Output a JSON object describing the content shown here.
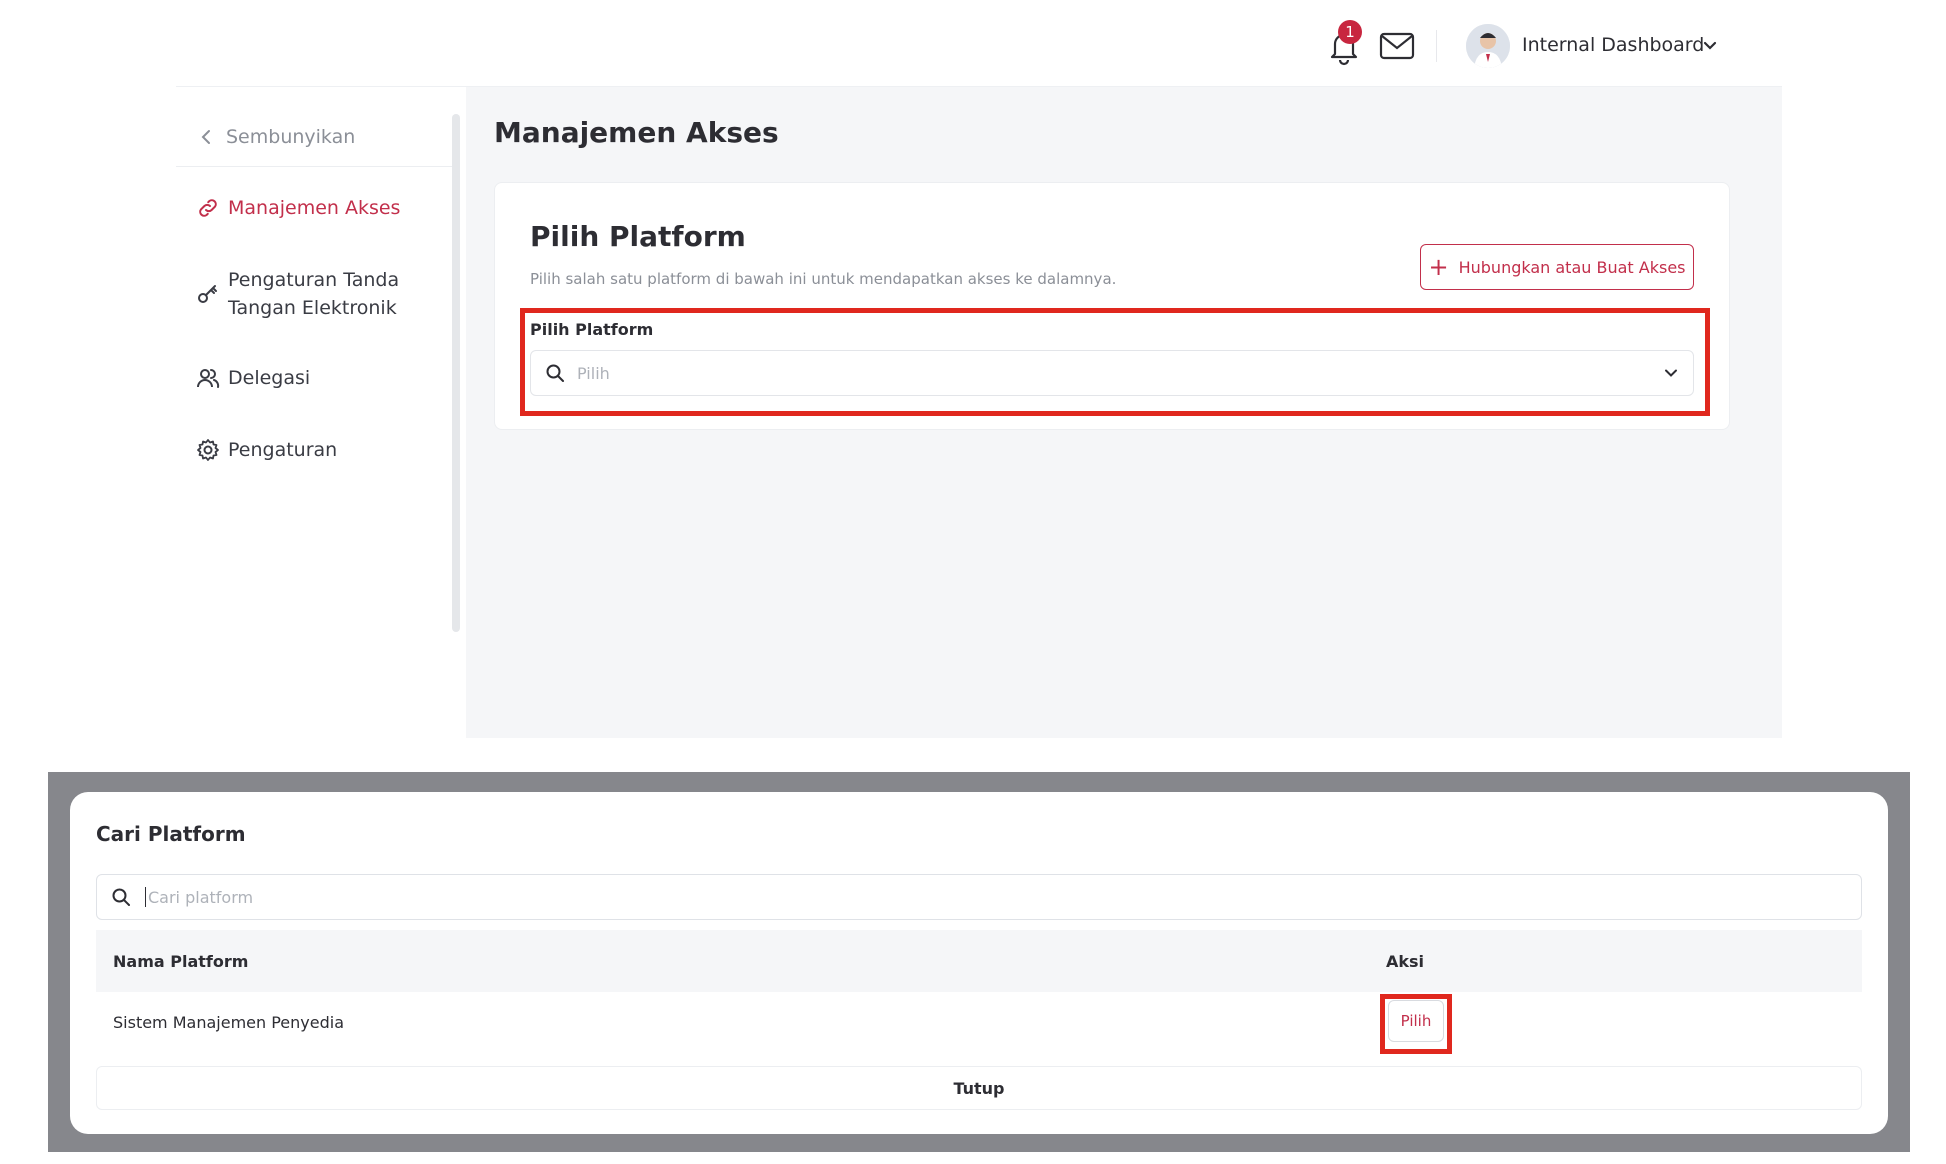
{
  "header": {
    "notification_count": "1",
    "user_name": "Internal Dashboard"
  },
  "sidebar": {
    "hide_label": "Sembunyikan",
    "items": [
      {
        "label": "Manajemen Akses",
        "icon": "link-icon",
        "active": true
      },
      {
        "label_line1": "Pengaturan Tanda",
        "label_line2": "Tangan Elektronik",
        "icon": "key-icon"
      },
      {
        "label": "Delegasi",
        "icon": "users-icon"
      },
      {
        "label": "Pengaturan",
        "icon": "gear-icon"
      }
    ]
  },
  "main": {
    "page_title": "Manajemen Akses",
    "card": {
      "title": "Pilih Platform",
      "subtitle": "Pilih salah satu platform di bawah ini untuk mendapatkan akses ke dalamnya.",
      "connect_button": "Hubungkan atau Buat Akses",
      "field_label": "Pilih Platform",
      "select_placeholder": "Pilih"
    }
  },
  "modal": {
    "title": "Cari Platform",
    "search_placeholder": "Cari platform",
    "columns": [
      "Nama Platform",
      "Aksi"
    ],
    "rows": [
      {
        "name": "Sistem Manajemen Penyedia",
        "action": "Pilih"
      }
    ],
    "close_button": "Tutup"
  },
  "colors": {
    "accent": "#c22f4b",
    "highlight": "#e0281e",
    "overlay": "#86878c"
  }
}
